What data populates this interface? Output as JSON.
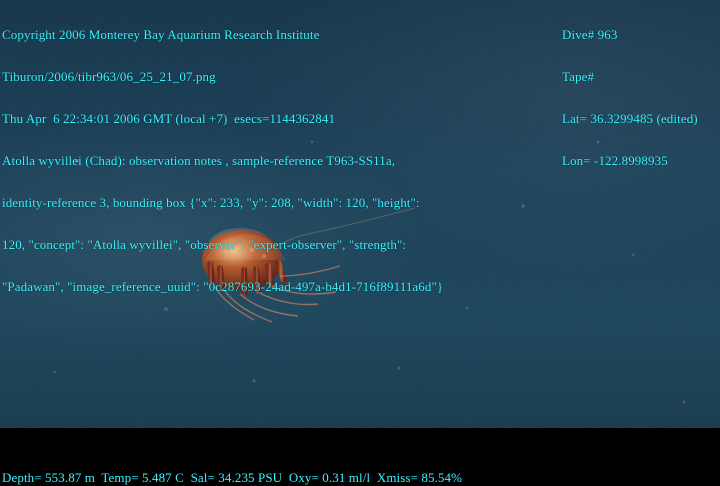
{
  "overlay": {
    "left_lines": [
      "Copyright 2006 Monterey Bay Aquarium Research Institute",
      "Tiburon/2006/tibr963/06_25_21_07.png",
      "Thu Apr  6 22:34:01 2006 GMT (local +7)  esecs=1144362841",
      "Atolla wyvillei (Chad): observation notes , sample-reference T963-SS11a,",
      "identity-reference 3, bounding box {\"x\": 233, \"y\": 208, \"width\": 120, \"height\":",
      "120, \"concept\": \"Atolla wyvillei\", \"observer\": \"expert-observer\", \"strength\":",
      "\"Padawan\", \"image_reference_uuid\": \"0c287693-24ad-497a-b4d1-716f89111a6d\"}"
    ],
    "right_lines": [
      "Dive# 963",
      "Tape#",
      "Lat= 36.3299485 (edited)",
      "Lon= -122.8998935"
    ],
    "bottom_line": "Depth= 553.87 m  Temp= 5.487 C  Sal= 34.235 PSU  Oxy= 0.31 ml/l  Xmiss= 85.54%"
  }
}
